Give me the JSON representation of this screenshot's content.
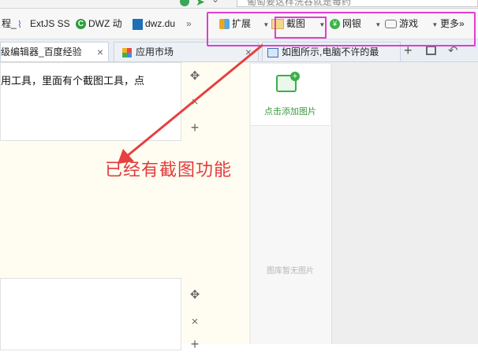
{
  "address_bar": {
    "value": "葡萄要这样洗吞就是毒药"
  },
  "bookmarks": {
    "item1_label": "程_",
    "item2_label": "ExtJS SS",
    "item3_label": "DWZ 动",
    "item4_label": "dwz.du",
    "overflow_label": "»"
  },
  "toolbar": {
    "extend_label": "扩展",
    "screenshot_label": "截图",
    "bank_label": "网银",
    "game_label": "游戏",
    "more_label": "更多»"
  },
  "tabs": [
    {
      "label": "级编辑器_百度经验",
      "close": "×"
    },
    {
      "label": "应用市场",
      "close": "×"
    },
    {
      "label": "如图所示,电脑不许的最"
    }
  ],
  "editor": {
    "line1": "用工具，里面有个截图工具，点"
  },
  "annotation": {
    "text": "已经有截图功能",
    "color": "#e33b3b",
    "highlight_color": "#e23cd2"
  },
  "side_panel": {
    "add_image_label": "点击添加图片",
    "empty_label": "图库暂无图片"
  },
  "icons": [
    "chevron-down-icon",
    "arrow-icon",
    "search-icon",
    "star-icon",
    "grid-icon",
    "green-c-icon",
    "chart-icon",
    "puzzle-icon",
    "scissors-icon",
    "yen-shield-icon",
    "gamepad-icon",
    "image-icon",
    "move-icon",
    "close-icon",
    "plus-icon",
    "new-tab-icon",
    "restore-icon",
    "undo-icon",
    "add-image-icon"
  ]
}
